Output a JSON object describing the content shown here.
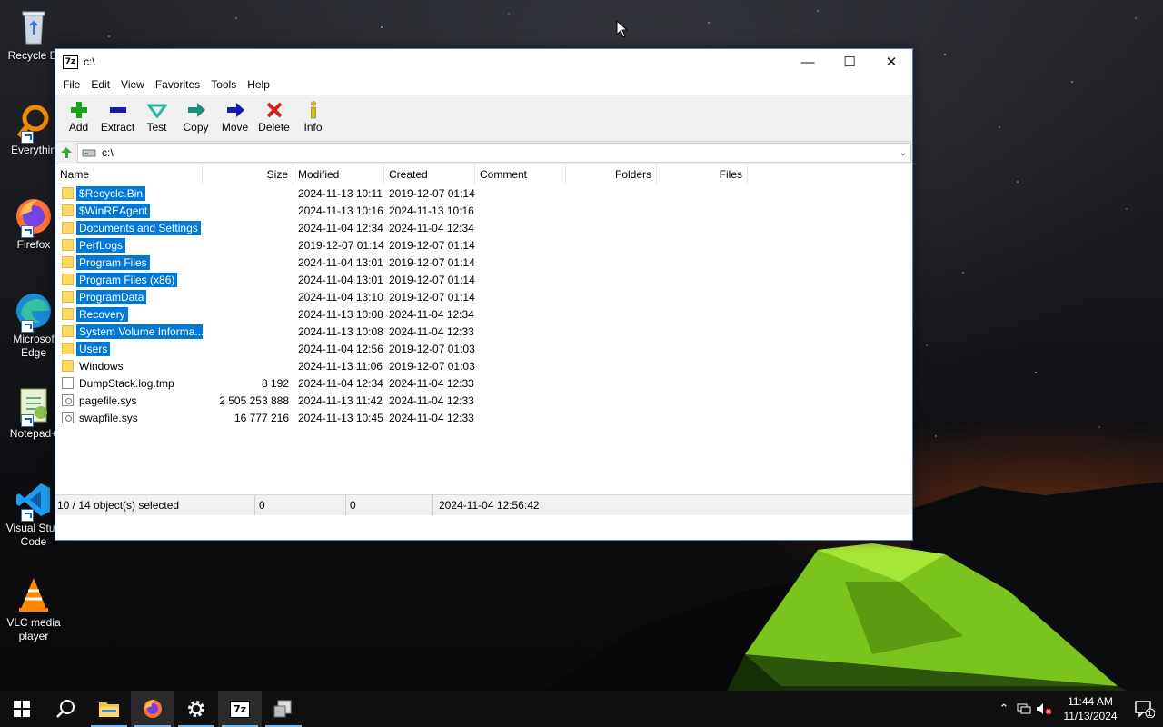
{
  "desktop": {
    "icons": [
      {
        "label": "Recycle Bi",
        "icon": "recycle-bin-icon"
      },
      {
        "label": "Everythin",
        "icon": "everything-search-icon"
      },
      {
        "label": "Firefox",
        "icon": "firefox-icon"
      },
      {
        "label": "Microsof Edge",
        "icon": "edge-icon"
      },
      {
        "label": "Notepad+",
        "icon": "notepad-plus-plus-icon"
      },
      {
        "label": "Visual Stud Code",
        "icon": "vscode-icon"
      },
      {
        "label": "VLC media player",
        "icon": "vlc-icon"
      }
    ]
  },
  "window": {
    "title": "c:\\",
    "app_icon_text": "7z",
    "controls": {
      "minimize": "—",
      "maximize": "☐",
      "close": "✕"
    },
    "menu": [
      "File",
      "Edit",
      "View",
      "Favorites",
      "Tools",
      "Help"
    ],
    "toolbar": [
      {
        "label": "Add",
        "icon": "add-icon",
        "color": "#19a319"
      },
      {
        "label": "Extract",
        "icon": "extract-icon",
        "color": "#1a1aa8"
      },
      {
        "label": "Test",
        "icon": "test-icon",
        "color": "#2bb3a3"
      },
      {
        "label": "Copy",
        "icon": "copy-icon",
        "color": "#1f8b7a"
      },
      {
        "label": "Move",
        "icon": "move-icon",
        "color": "#1a1aa8"
      },
      {
        "label": "Delete",
        "icon": "delete-icon",
        "color": "#d42020"
      },
      {
        "label": "Info",
        "icon": "info-icon",
        "color": "#d8c400"
      }
    ],
    "address": "c:\\",
    "columns": {
      "name": "Name",
      "size": "Size",
      "modified": "Modified",
      "created": "Created",
      "comment": "Comment",
      "folders": "Folders",
      "files": "Files"
    },
    "rows": [
      {
        "name": "$Recycle.Bin",
        "size": "",
        "modified": "2024-11-13 10:11",
        "created": "2019-12-07 01:14",
        "type": "folder",
        "selected": true
      },
      {
        "name": "$WinREAgent",
        "size": "",
        "modified": "2024-11-13 10:16",
        "created": "2024-11-13 10:16",
        "type": "folder",
        "selected": true
      },
      {
        "name": "Documents and Settings",
        "size": "",
        "modified": "2024-11-04 12:34",
        "created": "2024-11-04 12:34",
        "type": "folder",
        "selected": true
      },
      {
        "name": "PerfLogs",
        "size": "",
        "modified": "2019-12-07 01:14",
        "created": "2019-12-07 01:14",
        "type": "folder",
        "selected": true
      },
      {
        "name": "Program Files",
        "size": "",
        "modified": "2024-11-04 13:01",
        "created": "2019-12-07 01:14",
        "type": "folder",
        "selected": true
      },
      {
        "name": "Program Files (x86)",
        "size": "",
        "modified": "2024-11-04 13:01",
        "created": "2019-12-07 01:14",
        "type": "folder",
        "selected": true
      },
      {
        "name": "ProgramData",
        "size": "",
        "modified": "2024-11-04 13:10",
        "created": "2019-12-07 01:14",
        "type": "folder",
        "selected": true
      },
      {
        "name": "Recovery",
        "size": "",
        "modified": "2024-11-13 10:08",
        "created": "2024-11-04 12:34",
        "type": "folder",
        "selected": true
      },
      {
        "name": "System Volume Informa...",
        "size": "",
        "modified": "2024-11-13 10:08",
        "created": "2024-11-04 12:33",
        "type": "folder",
        "selected": true
      },
      {
        "name": "Users",
        "size": "",
        "modified": "2024-11-04 12:56",
        "created": "2019-12-07 01:03",
        "type": "folder",
        "selected": true
      },
      {
        "name": "Windows",
        "size": "",
        "modified": "2024-11-13 11:06",
        "created": "2019-12-07 01:03",
        "type": "folder",
        "selected": false
      },
      {
        "name": "DumpStack.log.tmp",
        "size": "8 192",
        "modified": "2024-11-04 12:34",
        "created": "2024-11-04 12:33",
        "type": "file",
        "selected": false
      },
      {
        "name": "pagefile.sys",
        "size": "2 505 253 888",
        "modified": "2024-11-13 11:42",
        "created": "2024-11-04 12:33",
        "type": "sys",
        "selected": false
      },
      {
        "name": "swapfile.sys",
        "size": "16 777 216",
        "modified": "2024-11-13 10:45",
        "created": "2024-11-04 12:33",
        "type": "sys",
        "selected": false
      }
    ],
    "status": {
      "selection": "10 / 14 object(s) selected",
      "size": "0",
      "packed": "0",
      "date": "2024-11-04 12:56:42"
    },
    "selection_color": "#0078d7"
  },
  "taskbar": {
    "items": [
      {
        "name": "start",
        "icon": "windows-start-icon"
      },
      {
        "name": "search",
        "icon": "search-icon"
      },
      {
        "name": "file-explorer",
        "icon": "folder-icon"
      },
      {
        "name": "firefox",
        "icon": "firefox-icon"
      },
      {
        "name": "settings",
        "icon": "gear-icon"
      },
      {
        "name": "7zip",
        "icon": "7zip-icon",
        "label": "7z"
      },
      {
        "name": "vm-tools",
        "icon": "computer-icon"
      }
    ],
    "clock": {
      "time": "11:44 AM",
      "date": "11/13/2024"
    },
    "notification_count": "1"
  }
}
